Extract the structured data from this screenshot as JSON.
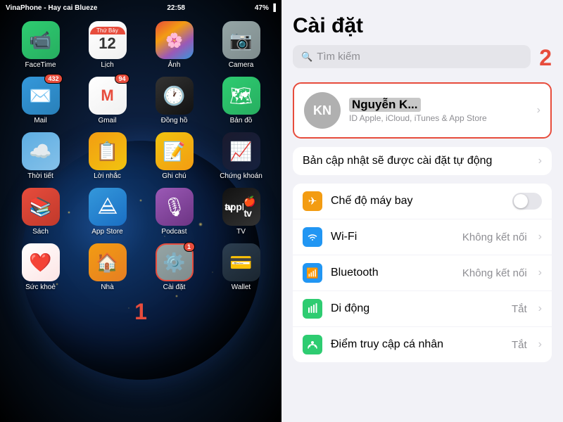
{
  "phone": {
    "carrier": "VinaPhone - Hay cai Blueze",
    "time": "22:58",
    "battery": "47%",
    "step_number": "1",
    "apps": {
      "row1": [
        {
          "id": "facetime",
          "label": "FaceTime",
          "icon": "📹",
          "class": "icon-facetime",
          "badge": null
        },
        {
          "id": "lich",
          "label": "Lịch",
          "icon": "",
          "class": "icon-lich",
          "badge": null,
          "special": "calendar",
          "header": "Thứ Bảy",
          "date": "12"
        },
        {
          "id": "anh",
          "label": "Ảnh",
          "icon": "🌸",
          "class": "icon-anh",
          "badge": null
        },
        {
          "id": "camera",
          "label": "Camera",
          "icon": "📷",
          "class": "icon-camera",
          "badge": null
        }
      ],
      "row2": [
        {
          "id": "mail",
          "label": "Mail",
          "icon": "✉️",
          "class": "icon-mail",
          "badge": "432"
        },
        {
          "id": "gmail",
          "label": "Gmail",
          "icon": "M",
          "class": "icon-gmail",
          "badge": "94"
        },
        {
          "id": "dongho",
          "label": "Đồng hồ",
          "icon": "🕐",
          "class": "icon-dongho",
          "badge": null
        },
        {
          "id": "bando",
          "label": "Bản đồ",
          "icon": "🗺",
          "class": "icon-bando",
          "badge": null
        }
      ],
      "row3": [
        {
          "id": "thoitiet",
          "label": "Thời tiết",
          "icon": "☁️",
          "class": "icon-thoitiet",
          "badge": null
        },
        {
          "id": "loinhac",
          "label": "Lời nhắc",
          "icon": "📋",
          "class": "icon-loinhac",
          "badge": null
        },
        {
          "id": "ghichu",
          "label": "Ghi chú",
          "icon": "📝",
          "class": "icon-ghichu",
          "badge": null
        },
        {
          "id": "chungkhoan",
          "label": "Chứng khoán",
          "icon": "📈",
          "class": "icon-chungkhoan",
          "badge": null
        }
      ],
      "row4": [
        {
          "id": "sach",
          "label": "Sách",
          "icon": "📚",
          "class": "icon-sach",
          "badge": null
        },
        {
          "id": "appstore",
          "label": "App Store",
          "icon": "Ⓐ",
          "class": "icon-appstore",
          "badge": null
        },
        {
          "id": "podcast",
          "label": "Podcast",
          "icon": "🎙",
          "class": "icon-podcast",
          "badge": null
        },
        {
          "id": "tv",
          "label": "TV",
          "icon": "📺",
          "class": "icon-tv",
          "badge": null
        }
      ],
      "row5": [
        {
          "id": "suckhoe",
          "label": "Sức khoẻ",
          "icon": "❤️",
          "class": "icon-suckhoe",
          "badge": null
        },
        {
          "id": "nha",
          "label": "Nhà",
          "icon": "🏠",
          "class": "icon-nha",
          "badge": null
        },
        {
          "id": "caidat",
          "label": "Cài đặt",
          "icon": "⚙️",
          "class": "icon-caidat",
          "badge": "1",
          "highlighted": true
        },
        {
          "id": "wallet",
          "label": "Wallet",
          "icon": "💳",
          "class": "icon-wallet",
          "badge": null
        }
      ]
    }
  },
  "settings": {
    "title": "Cài đặt",
    "step_number": "2",
    "search_placeholder": "Tìm kiếm",
    "profile": {
      "initials": "KN",
      "name": "Nguyễn K...",
      "subtitle": "ID Apple, iCloud, iTunes & App Store"
    },
    "update_row": {
      "label": "Bản cập nhật sẽ được cài đặt tự động"
    },
    "rows": [
      {
        "id": "airplane",
        "label": "Chế độ máy bay",
        "icon": "✈",
        "icon_class": "icon-airplane",
        "value": "",
        "has_toggle": true
      },
      {
        "id": "wifi",
        "label": "Wi-Fi",
        "icon": "📶",
        "icon_class": "icon-wifi",
        "value": "Không kết nối",
        "has_toggle": false
      },
      {
        "id": "bluetooth",
        "label": "Bluetooth",
        "icon": "🔷",
        "icon_class": "icon-bluetooth",
        "value": "Không kết nối",
        "has_toggle": false
      },
      {
        "id": "mobile",
        "label": "Di động",
        "icon": "📡",
        "icon_class": "icon-mobile",
        "value": "Tắt",
        "has_toggle": false
      },
      {
        "id": "accessibility",
        "label": "Điểm truy cập cá nhân",
        "icon": "🔗",
        "icon_class": "icon-accessibility",
        "value": "Tắt",
        "has_toggle": false
      }
    ]
  }
}
